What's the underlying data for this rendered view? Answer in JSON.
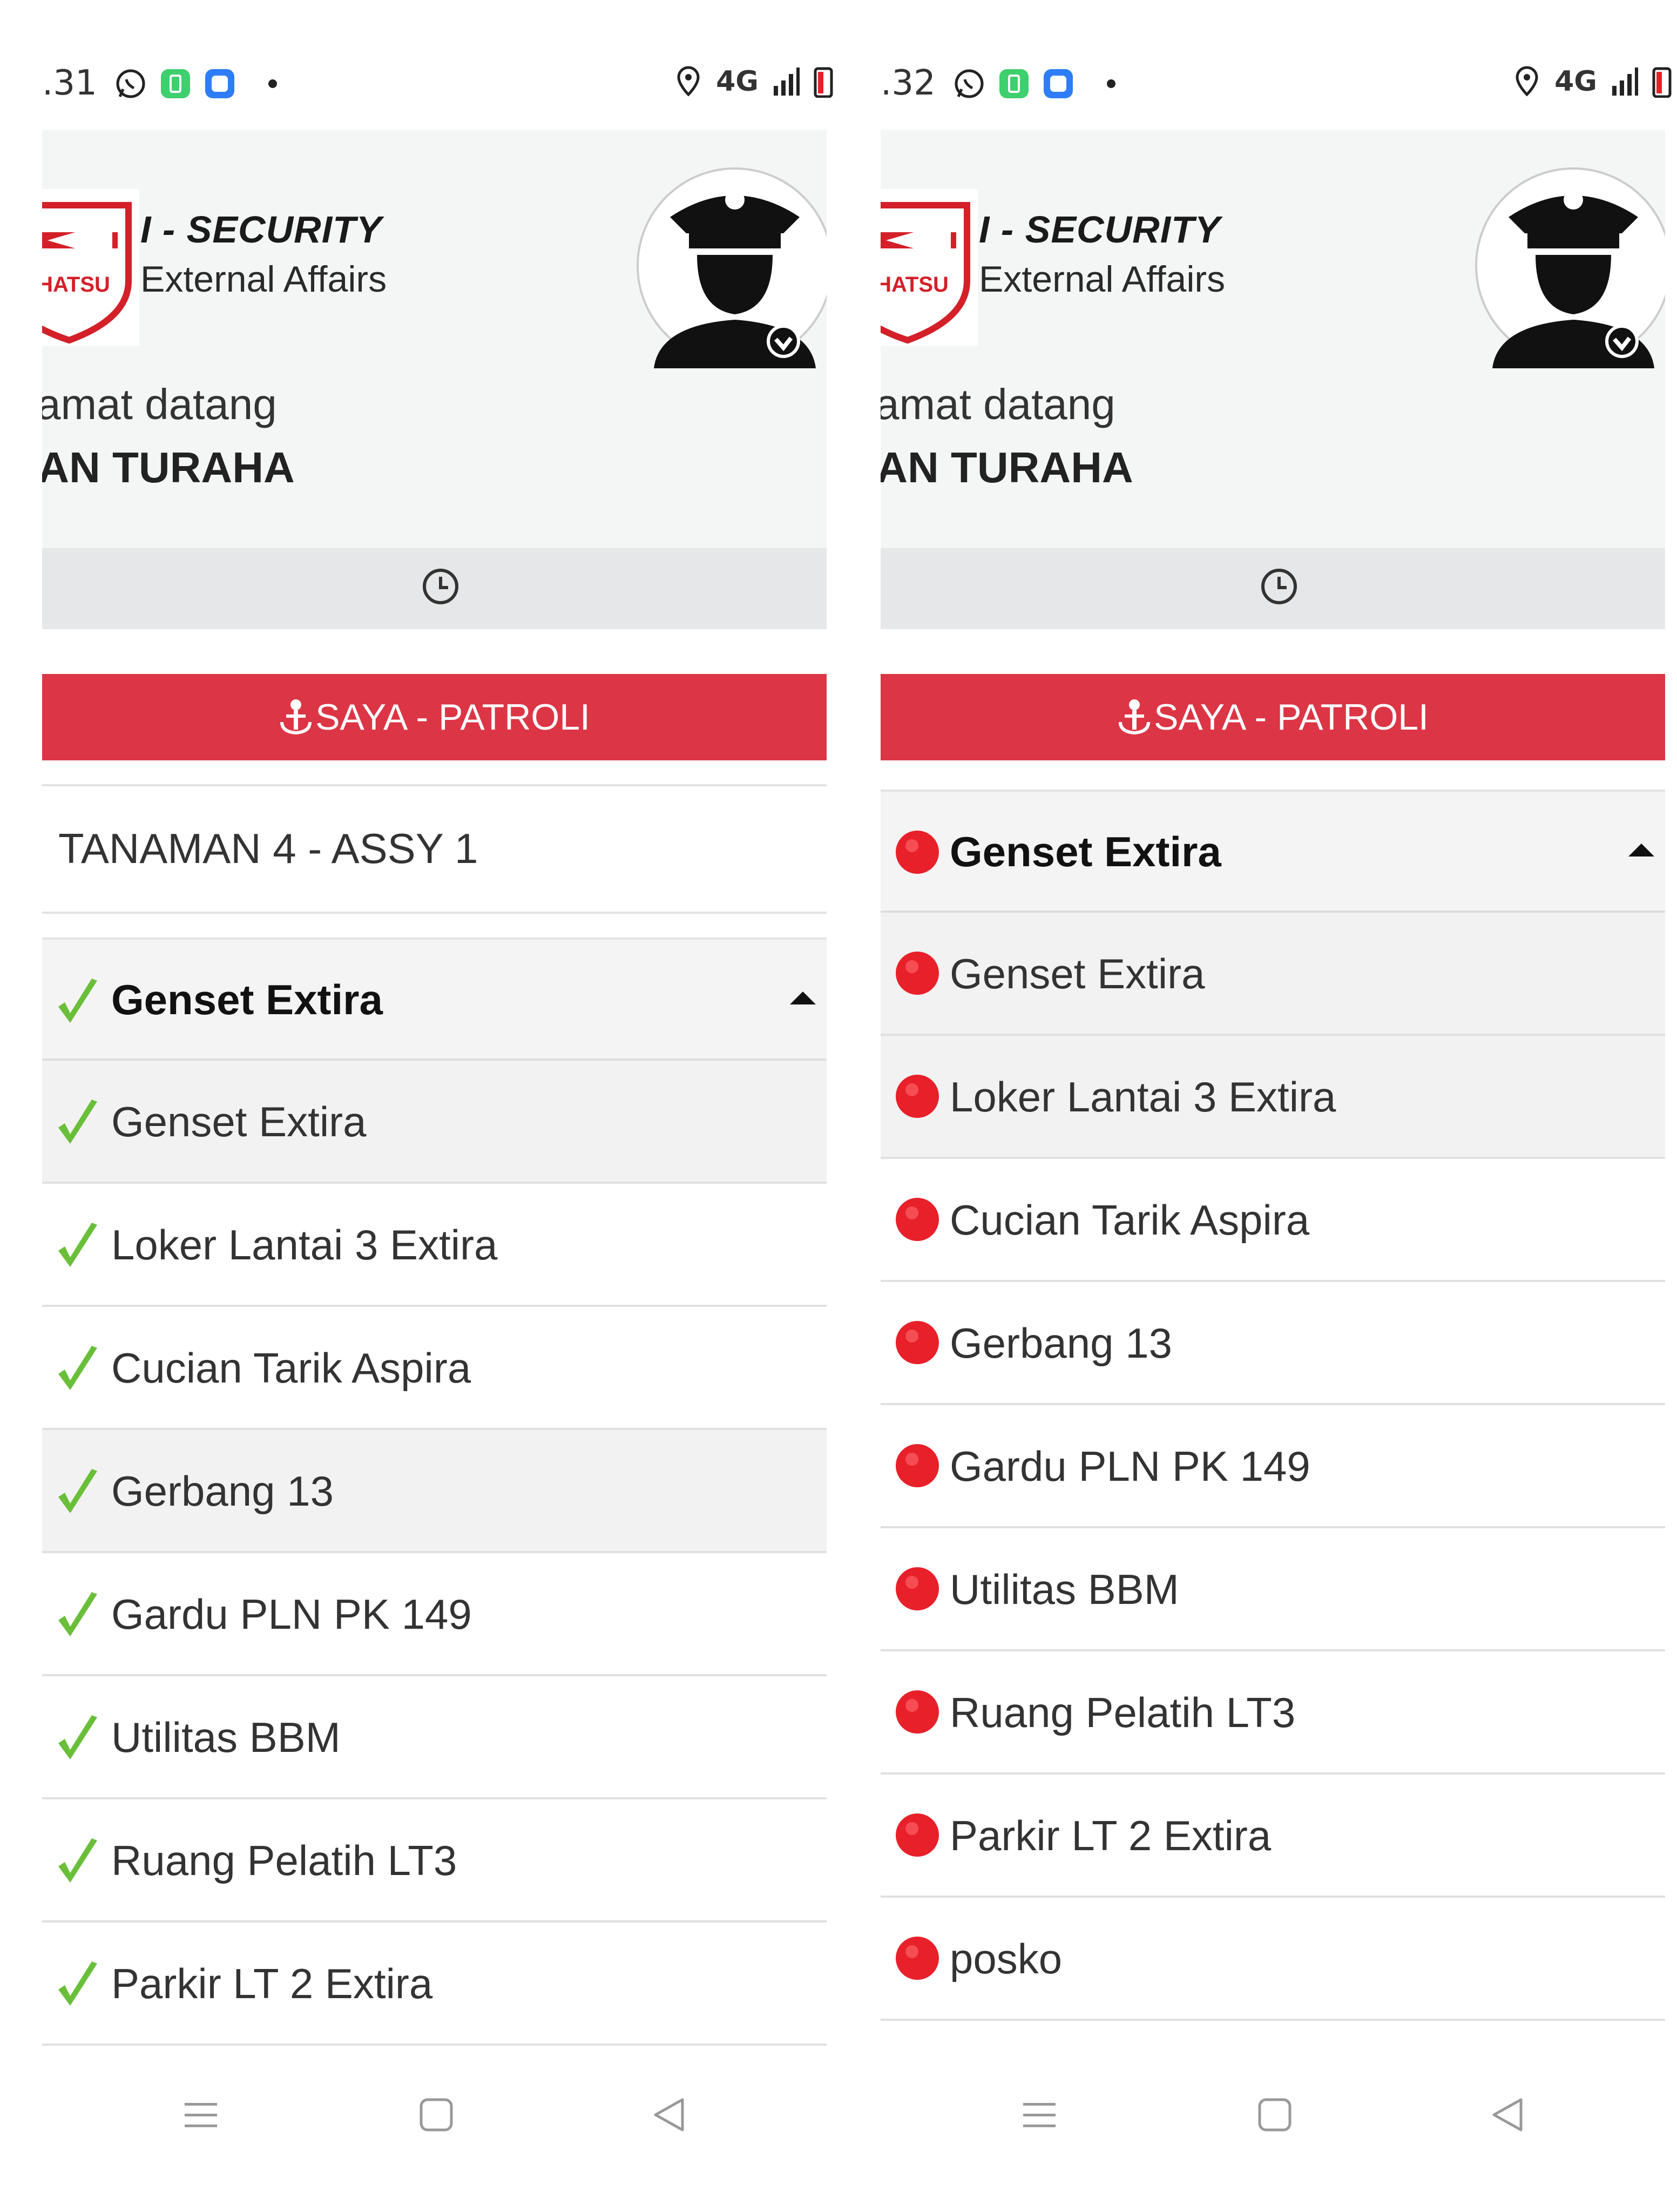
{
  "screens": [
    {
      "status_bar": {
        "time": ".31",
        "network": "4G"
      },
      "header": {
        "brand_text": "IHATSU",
        "app_title": "I - SECURITY",
        "app_subtitle": "External Affairs",
        "welcome": "amat datang",
        "username": "IAN TURAHA"
      },
      "patrol_button_label": "SAYA - PATROLI",
      "area_label": "TANAMAN 4 - ASSY 1",
      "group": {
        "label": "Genset Extira",
        "status": "done",
        "expanded": true
      },
      "checkpoints": [
        {
          "label": "Genset Extira",
          "status": "done"
        },
        {
          "label": "Loker Lantai 3 Extira",
          "status": "done"
        },
        {
          "label": "Cucian Tarik Aspira",
          "status": "done"
        },
        {
          "label": "Gerbang 13",
          "status": "done"
        },
        {
          "label": "Gardu PLN PK 149",
          "status": "done"
        },
        {
          "label": "Utilitas BBM",
          "status": "done"
        },
        {
          "label": "Ruang Pelatih LT3",
          "status": "done"
        },
        {
          "label": "Parkir LT 2 Extira",
          "status": "done"
        }
      ]
    },
    {
      "status_bar": {
        "time": ".32",
        "network": "4G"
      },
      "header": {
        "brand_text": "IHATSU",
        "app_title": "I - SECURITY",
        "app_subtitle": "External Affairs",
        "welcome": "amat datang",
        "username": "IAN TURAHA"
      },
      "patrol_button_label": "SAYA - PATROLI",
      "group": {
        "label": "Genset Extira",
        "status": "pending",
        "expanded": true
      },
      "checkpoints": [
        {
          "label": "Genset Extira",
          "status": "pending"
        },
        {
          "label": "Loker Lantai 3 Extira",
          "status": "pending"
        },
        {
          "label": "Cucian Tarik Aspira",
          "status": "pending"
        },
        {
          "label": "Gerbang 13",
          "status": "pending"
        },
        {
          "label": "Gardu PLN PK 149",
          "status": "pending"
        },
        {
          "label": "Utilitas BBM",
          "status": "pending"
        },
        {
          "label": "Ruang Pelatih LT3",
          "status": "pending"
        },
        {
          "label": "Parkir LT 2 Extira",
          "status": "pending"
        },
        {
          "label": "posko",
          "status": "pending"
        }
      ]
    }
  ],
  "colors": {
    "accent_red": "#dc3545",
    "check_green": "#6abf3a",
    "pending_red": "#e8202a",
    "header_bg": "#f4f6f6",
    "clock_bar_bg": "#e6e7e8"
  },
  "icons": {
    "status_bar": [
      "whatsapp-icon",
      "battery-saver-icon",
      "app-square-icon",
      "dot-icon",
      "location-icon",
      "signal-icon",
      "battery-icon"
    ],
    "clock": "clock-icon",
    "patrol": "anchor-person-icon",
    "done": "green-check-icon",
    "pending": "red-dot-icon",
    "nav": [
      "menu-icon",
      "home-icon",
      "back-icon"
    ]
  }
}
